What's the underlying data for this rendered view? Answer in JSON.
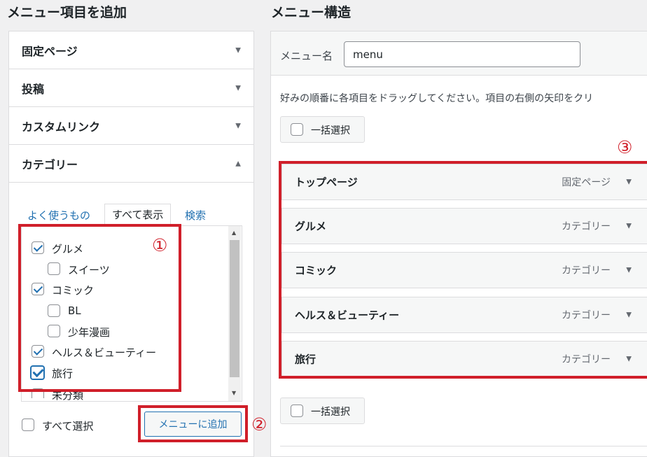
{
  "left": {
    "heading": "メニュー項目を追加",
    "accordion": [
      {
        "label": "固定ページ",
        "arrow": "▼"
      },
      {
        "label": "投稿",
        "arrow": "▼"
      },
      {
        "label": "カスタムリンク",
        "arrow": "▼"
      },
      {
        "label": "カテゴリー",
        "arrow": "▲"
      }
    ],
    "tabs": {
      "most_used": "よく使うもの",
      "view_all": "すべて表示",
      "search": "検索"
    },
    "categories": [
      {
        "label": "グルメ",
        "checked": true
      },
      {
        "label": "スイーツ",
        "checked": false
      },
      {
        "label": "コミック",
        "checked": true
      },
      {
        "label": "BL",
        "checked": false
      },
      {
        "label": "少年漫画",
        "checked": false
      },
      {
        "label": "ヘルス＆ビューティー",
        "checked": true
      },
      {
        "label": "旅行",
        "checked": true
      },
      {
        "label": "未分類",
        "checked": false
      }
    ],
    "select_all": "すべて選択",
    "add_button": "メニューに追加"
  },
  "right": {
    "heading": "メニュー構造",
    "menu_name_label": "メニュー名",
    "menu_name_value": "menu",
    "instructions": "好みの順番に各項目をドラッグしてください。項目の右側の矢印をクリ",
    "bulk_select": "一括選択",
    "items": [
      {
        "title": "トップページ",
        "type": "固定ページ"
      },
      {
        "title": "グルメ",
        "type": "カテゴリー"
      },
      {
        "title": "コミック",
        "type": "カテゴリー"
      },
      {
        "title": "ヘルス＆ビューティー",
        "type": "カテゴリー"
      },
      {
        "title": "旅行",
        "type": "カテゴリー"
      }
    ],
    "item_arrow": "▼"
  },
  "annotations": {
    "one": "①",
    "two": "②",
    "three": "③"
  },
  "colors": {
    "annotation_red": "#d01f2a",
    "link_blue": "#2271b1",
    "checkbox_blue": "#2271b1"
  }
}
